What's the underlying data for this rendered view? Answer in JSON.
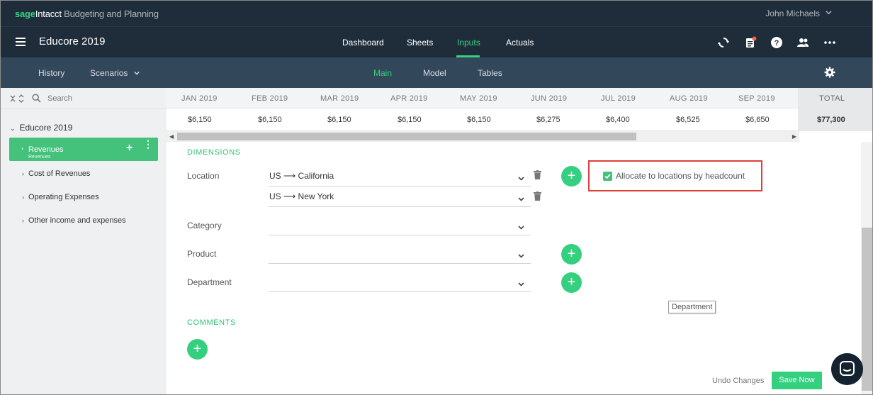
{
  "brand": {
    "sage": "sage",
    "intacct": "Intacct",
    "rest": " Budgeting and Planning"
  },
  "user": {
    "name": "John Michaels"
  },
  "app": {
    "title": "Educore 2019"
  },
  "nav": {
    "tabs": [
      "Dashboard",
      "Sheets",
      "Inputs",
      "Actuals"
    ],
    "active": "Inputs"
  },
  "subnav": {
    "history": "History",
    "scenarios": "Scenarios",
    "tabs": [
      "Main",
      "Model",
      "Tables"
    ],
    "active": "Main"
  },
  "sidebar": {
    "search_placeholder": "Search",
    "root": "Educore 2019",
    "selected": {
      "label": "Revenues",
      "sublabel": "Revenues"
    },
    "items": [
      "Cost of Revenues",
      "Operating Expenses",
      "Other income and expenses"
    ]
  },
  "grid": {
    "months": [
      "JAN 2019",
      "FEB 2019",
      "MAR 2019",
      "APR 2019",
      "MAY 2019",
      "JUN 2019",
      "JUL 2019",
      "AUG 2019",
      "SEP 2019"
    ],
    "values": [
      "$6,150",
      "$6,150",
      "$6,150",
      "$6,150",
      "$6,150",
      "$6,275",
      "$6,400",
      "$6,525",
      "$6,650"
    ],
    "total_label": "TOTAL",
    "total_value": "$77,300"
  },
  "dimensions": {
    "title": "DIMENSIONS",
    "location_label": "Location",
    "locations": [
      "US ⟶ California",
      "US ⟶ New York"
    ],
    "category_label": "Category",
    "product_label": "Product",
    "department_label": "Department",
    "allocate_label": "Allocate to locations by headcount",
    "tooltip": "Department"
  },
  "comments": {
    "title": "COMMENTS"
  },
  "actions": {
    "undo": "Undo Changes",
    "save": "Save Now"
  },
  "colors": {
    "accent": "#34d07f",
    "header": "#1f2d3a",
    "subheader": "#33475b",
    "highlight_border": "#e0403a"
  }
}
